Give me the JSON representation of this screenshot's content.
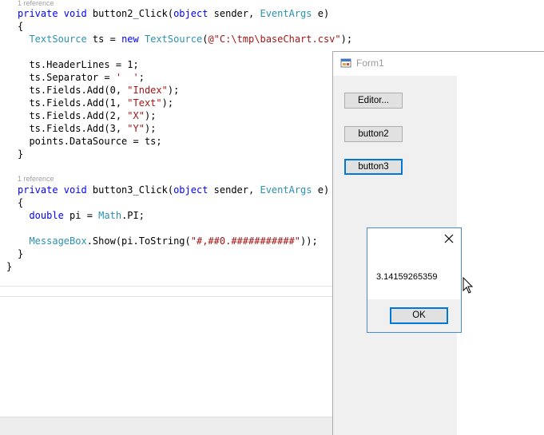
{
  "editor": {
    "codelens": [
      "1 reference",
      "1 reference"
    ],
    "lines": [
      [
        {
          "t": "private void ",
          "c": "kw"
        },
        {
          "t": "button2_Click(",
          "c": ""
        },
        {
          "t": "object",
          "c": "kw"
        },
        {
          "t": " sender, ",
          "c": ""
        },
        {
          "t": "EventArgs",
          "c": "ty"
        },
        {
          "t": " e)",
          "c": ""
        }
      ],
      [
        {
          "t": "{",
          "c": ""
        }
      ],
      [
        {
          "t": "  ",
          "c": ""
        },
        {
          "t": "TextSource",
          "c": "ty"
        },
        {
          "t": " ts = ",
          "c": ""
        },
        {
          "t": "new ",
          "c": "kw"
        },
        {
          "t": "TextSource",
          "c": "ty"
        },
        {
          "t": "(",
          "c": ""
        },
        {
          "t": "@\"C:\\tmp\\baseChart.csv\"",
          "c": "str"
        },
        {
          "t": ");",
          "c": ""
        }
      ],
      [
        {
          "t": "",
          "c": ""
        }
      ],
      [
        {
          "t": "  ts.HeaderLines = 1;",
          "c": ""
        }
      ],
      [
        {
          "t": "  ts.Separator = ",
          "c": ""
        },
        {
          "t": "'  '",
          "c": "str"
        },
        {
          "t": ";",
          "c": ""
        }
      ],
      [
        {
          "t": "  ts.Fields.Add(0, ",
          "c": ""
        },
        {
          "t": "\"Index\"",
          "c": "str"
        },
        {
          "t": ");",
          "c": ""
        }
      ],
      [
        {
          "t": "  ts.Fields.Add(1, ",
          "c": ""
        },
        {
          "t": "\"Text\"",
          "c": "str"
        },
        {
          "t": ");",
          "c": ""
        }
      ],
      [
        {
          "t": "  ts.Fields.Add(2, ",
          "c": ""
        },
        {
          "t": "\"X\"",
          "c": "str"
        },
        {
          "t": ");",
          "c": ""
        }
      ],
      [
        {
          "t": "  ts.Fields.Add(3, ",
          "c": ""
        },
        {
          "t": "\"Y\"",
          "c": "str"
        },
        {
          "t": ");",
          "c": ""
        }
      ],
      [
        {
          "t": "  points.DataSource = ts;",
          "c": ""
        }
      ],
      [
        {
          "t": "}",
          "c": ""
        }
      ],
      [
        {
          "t": "private void ",
          "c": "kw"
        },
        {
          "t": "button3_Click(",
          "c": ""
        },
        {
          "t": "object",
          "c": "kw"
        },
        {
          "t": " sender, ",
          "c": ""
        },
        {
          "t": "EventArgs",
          "c": "ty"
        },
        {
          "t": " e)",
          "c": ""
        }
      ],
      [
        {
          "t": "{",
          "c": ""
        }
      ],
      [
        {
          "t": "  ",
          "c": ""
        },
        {
          "t": "double",
          "c": "kw"
        },
        {
          "t": " pi = ",
          "c": ""
        },
        {
          "t": "Math",
          "c": "ty"
        },
        {
          "t": ".PI;",
          "c": ""
        }
      ],
      [
        {
          "t": "",
          "c": ""
        }
      ],
      [
        {
          "t": "  ",
          "c": ""
        },
        {
          "t": "MessageBox",
          "c": "ty"
        },
        {
          "t": ".Show(pi.ToString(",
          "c": ""
        },
        {
          "t": "\"#,##0.###########\"",
          "c": "str"
        },
        {
          "t": "));",
          "c": ""
        }
      ],
      [
        {
          "t": "}",
          "c": ""
        }
      ],
      [
        {
          "t": "}",
          "c": ""
        }
      ]
    ]
  },
  "form1": {
    "title": "Form1",
    "buttons": {
      "editor": "Editor...",
      "button2": "button2",
      "button3": "button3"
    }
  },
  "messagebox": {
    "text": "3.14159265359",
    "ok_label": "OK"
  }
}
